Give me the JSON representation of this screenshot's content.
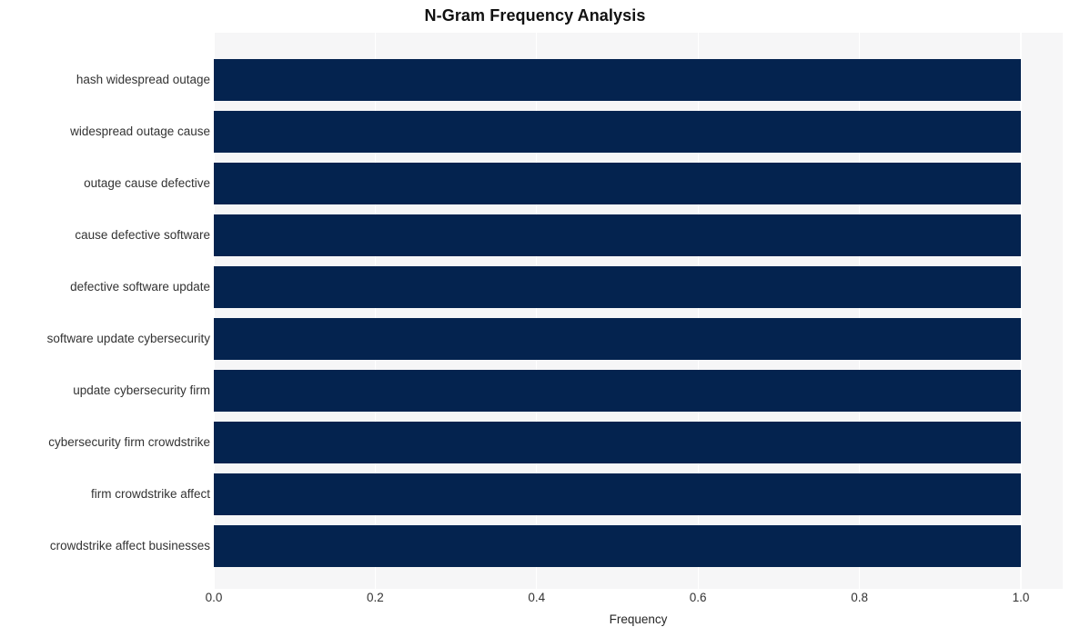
{
  "chart_data": {
    "type": "bar",
    "orientation": "horizontal",
    "title": "N-Gram Frequency Analysis",
    "xlabel": "Frequency",
    "ylabel": "",
    "xlim": [
      0.0,
      1.0
    ],
    "xticks": [
      "0.0",
      "0.2",
      "0.4",
      "0.6",
      "0.8",
      "1.0"
    ],
    "xtick_values": [
      0.0,
      0.2,
      0.4,
      0.6,
      0.8,
      1.0
    ],
    "grid": true,
    "grid_axis": "x",
    "legend": "none",
    "bar_color": "#04234f",
    "plot_background": "#f6f6f7",
    "figure_background": "#ffffff",
    "categories": [
      "hash widespread outage",
      "widespread outage cause",
      "outage cause defective",
      "cause defective software",
      "defective software update",
      "software update cybersecurity",
      "update cybersecurity firm",
      "cybersecurity firm crowdstrike",
      "firm crowdstrike affect",
      "crowdstrike affect businesses"
    ],
    "values": [
      1.0,
      1.0,
      1.0,
      1.0,
      1.0,
      1.0,
      1.0,
      1.0,
      1.0,
      1.0
    ]
  }
}
